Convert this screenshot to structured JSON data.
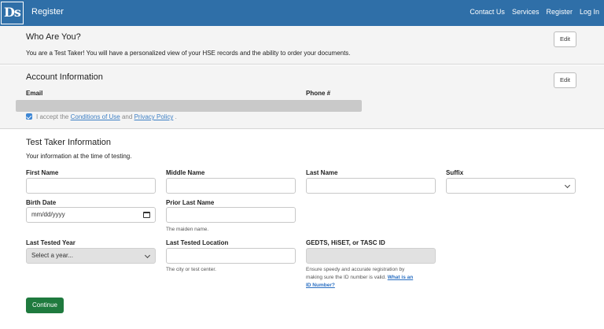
{
  "nav": {
    "logo_text": "Ds",
    "brand": "Register",
    "links": [
      "Contact Us",
      "Services",
      "Register",
      "Log In"
    ]
  },
  "who": {
    "title": "Who Are You?",
    "text": "You are a Test Taker! You will have a personalized view of your HSE records and the ability to order your documents.",
    "edit": "Edit"
  },
  "account": {
    "title": "Account Information",
    "edit": "Edit",
    "email_label": "Email",
    "phone_label": "Phone #",
    "accept_pre": "I accept the",
    "conditions_link": "Conditions of Use",
    "and": "and",
    "privacy_link": "Privacy Policy",
    "accept_post": ".",
    "accepted": true
  },
  "test_taker": {
    "title": "Test Taker Information",
    "subtitle": "Your information at the time of testing.",
    "first_name_label": "First Name",
    "middle_name_label": "Middle Name",
    "last_name_label": "Last Name",
    "suffix_label": "Suffix",
    "birth_date_label": "Birth Date",
    "birth_date_placeholder": "mm/dd/yyyy",
    "prior_last_name_label": "Prior Last Name",
    "prior_last_name_help": "The maiden name.",
    "last_tested_year_label": "Last Tested Year",
    "last_tested_year_value": "Select a year...",
    "last_tested_location_label": "Last Tested Location",
    "last_tested_location_help": "The city or test center.",
    "id_label": "GEDTS, HiSET, or TASC ID",
    "id_help_1": "Ensure speedy and accurate registration by",
    "id_help_2": "making sure the ID number is valid.",
    "id_help_link_1": "What is an",
    "id_help_link_2": "ID Number?",
    "continue": "Continue"
  }
}
